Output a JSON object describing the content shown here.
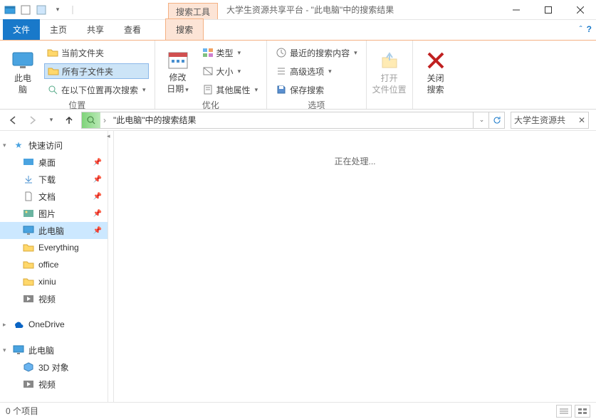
{
  "titlebar": {
    "tool_tab": "搜索工具",
    "title": "大学生资源共享平台 - \"此电脑\"中的搜索结果"
  },
  "tabs": {
    "file": "文件",
    "home": "主页",
    "share": "共享",
    "view": "查看",
    "search": "搜索"
  },
  "ribbon": {
    "group_location": {
      "label": "位置",
      "this_pc_l1": "此电",
      "this_pc_l2": "脑",
      "current_folder": "当前文件夹",
      "all_subfolders": "所有子文件夹",
      "search_again_in": "在以下位置再次搜索"
    },
    "group_refine": {
      "label": "优化",
      "date_l1": "修改",
      "date_l2": "日期",
      "kind": "类型",
      "size": "大小",
      "other": "其他属性"
    },
    "group_options": {
      "label": "选项",
      "recent": "最近的搜索内容",
      "advanced": "高级选项",
      "save": "保存搜索"
    },
    "open_loc_l1": "打开",
    "open_loc_l2": "文件位置",
    "close_l1": "关闭",
    "close_l2": "搜索"
  },
  "addr": {
    "path": "\"此电脑\"中的搜索结果",
    "search_value": "大学生资源共"
  },
  "nav": {
    "quick_access": "快速访问",
    "desktop": "桌面",
    "downloads": "下载",
    "documents": "文档",
    "pictures": "图片",
    "this_pc": "此电脑",
    "everything": "Everything",
    "office": "office",
    "xiniu": "xiniu",
    "videos": "视频",
    "onedrive": "OneDrive",
    "this_pc2": "此电脑",
    "obj3d": "3D 对象",
    "videos2": "视频"
  },
  "content": {
    "processing": "正在处理..."
  },
  "status": {
    "items": "0 个项目"
  }
}
